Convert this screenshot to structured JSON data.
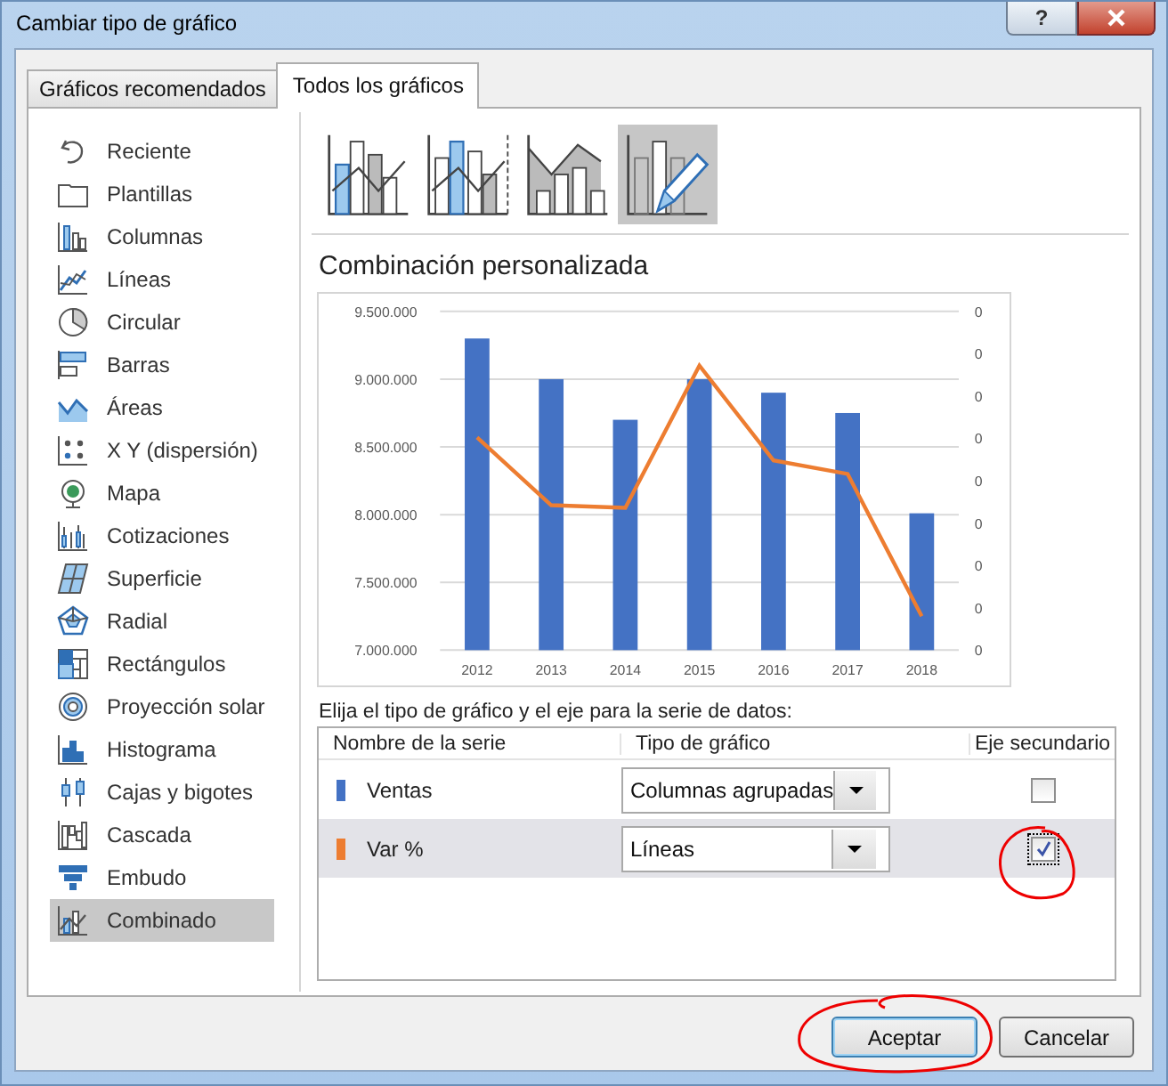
{
  "window": {
    "title": "Cambiar tipo de gráfico",
    "help": "?"
  },
  "tabs": [
    {
      "label": "Gráficos recomendados",
      "selected": false
    },
    {
      "label": "Todos los gráficos",
      "selected": true
    }
  ],
  "sidebar": {
    "items": [
      {
        "label": "Reciente",
        "kind": "recent",
        "selected": false
      },
      {
        "label": "Plantillas",
        "kind": "folder",
        "selected": false
      },
      {
        "label": "Columnas",
        "kind": "column",
        "selected": false
      },
      {
        "label": "Líneas",
        "kind": "line",
        "selected": false
      },
      {
        "label": "Circular",
        "kind": "pie",
        "selected": false
      },
      {
        "label": "Barras",
        "kind": "bar",
        "selected": false
      },
      {
        "label": "Áreas",
        "kind": "area",
        "selected": false
      },
      {
        "label": "X Y (dispersión)",
        "kind": "scatter",
        "selected": false
      },
      {
        "label": "Mapa",
        "kind": "globe",
        "selected": false
      },
      {
        "label": "Cotizaciones",
        "kind": "stock",
        "selected": false
      },
      {
        "label": "Superficie",
        "kind": "surface",
        "selected": false
      },
      {
        "label": "Radial",
        "kind": "radar",
        "selected": false
      },
      {
        "label": "Rectángulos",
        "kind": "treemap",
        "selected": false
      },
      {
        "label": "Proyección solar",
        "kind": "sunburst",
        "selected": false
      },
      {
        "label": "Histograma",
        "kind": "histogram",
        "selected": false
      },
      {
        "label": "Cajas y bigotes",
        "kind": "boxplot",
        "selected": false
      },
      {
        "label": "Cascada",
        "kind": "waterfall",
        "selected": false
      },
      {
        "label": "Embudo",
        "kind": "funnel",
        "selected": false
      },
      {
        "label": "Combinado",
        "kind": "combo",
        "selected": true
      }
    ]
  },
  "chart_types": [
    {
      "kind": "column-line",
      "selected": false
    },
    {
      "kind": "column-line-secondary",
      "selected": false
    },
    {
      "kind": "area-column",
      "selected": false
    },
    {
      "kind": "custom",
      "selected": true
    }
  ],
  "subtitle": "Combinación personalizada",
  "chart": {
    "chart_data": {
      "type": "bar",
      "categories": [
        "2012",
        "2013",
        "2014",
        "2015",
        "2016",
        "2017",
        "2018"
      ],
      "series": [
        {
          "color": "#4472c4",
          "values": [
            9300000,
            9000000,
            8700000,
            9000000,
            8900000,
            8750000,
            8010000
          ]
        },
        {
          "type": "line",
          "color": "#ed7d31",
          "values": [
            8570000,
            8070000,
            8050000,
            9100000,
            8400000,
            8300000,
            7250000
          ]
        }
      ],
      "grid": true,
      "ylim": [
        7000000,
        9500000
      ],
      "yticks": [
        {
          "value": 7000000,
          "label": "7.000.000"
        },
        {
          "value": 7500000,
          "label": "7.500.000"
        },
        {
          "value": 8000000,
          "label": "8.000.000"
        },
        {
          "value": 8500000,
          "label": "8.500.000"
        },
        {
          "value": 9000000,
          "label": "9.000.000"
        },
        {
          "value": 9500000,
          "label": "9.500.000"
        }
      ]
    },
    "secondary_axis_labels": [
      "0",
      "0",
      "0",
      "0",
      "0",
      "0",
      "0",
      "0",
      "0"
    ]
  },
  "series_table": {
    "prompt": "Elija el tipo de gráfico y el eje para la serie de datos:",
    "columns": [
      "Nombre de la serie",
      "Tipo de gráfico",
      "Eje secundario"
    ],
    "rows": [
      {
        "name": "Ventas",
        "color": "#4472c4",
        "chart_type": "Columnas agrupadas",
        "secondary_axis": false,
        "selected": false
      },
      {
        "name": "Var %",
        "color": "#ed7d31",
        "chart_type": "Líneas",
        "secondary_axis": true,
        "selected": true
      }
    ]
  },
  "buttons": [
    {
      "label": "Aceptar",
      "kind": "default"
    },
    {
      "label": "Cancelar",
      "kind": "normal"
    }
  ]
}
